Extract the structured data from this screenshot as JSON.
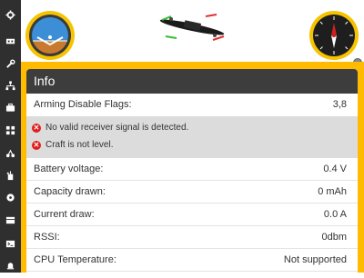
{
  "sidebar": {
    "icons": [
      "gear-icon",
      "ports-icon",
      "wrench-icon",
      "network-icon",
      "briefcase-icon",
      "modes-icon",
      "tuning-icon",
      "receiver-icon",
      "motors-icon",
      "blackbox-icon",
      "cli-icon",
      "bell-icon"
    ]
  },
  "info_panel": {
    "title": "Info",
    "arming": {
      "label": "Arming Disable Flags:",
      "value": "3,8"
    },
    "flags": [
      {
        "text": "No valid receiver signal is detected."
      },
      {
        "text": "Craft is not level."
      }
    ],
    "rows": [
      {
        "label": "Battery voltage:",
        "value": "0.4 V"
      },
      {
        "label": "Capacity drawn:",
        "value": "0 mAh"
      },
      {
        "label": "Current draw:",
        "value": "0.0 A"
      },
      {
        "label": "RSSI:",
        "value": "0dbm"
      },
      {
        "label": "CPU Temperature:",
        "value": "Not supported"
      }
    ]
  },
  "colors": {
    "accent": "#ffbb00",
    "sidebar": "#2f2f2f",
    "header": "#3d3d3d",
    "error": "#e21c1c"
  }
}
